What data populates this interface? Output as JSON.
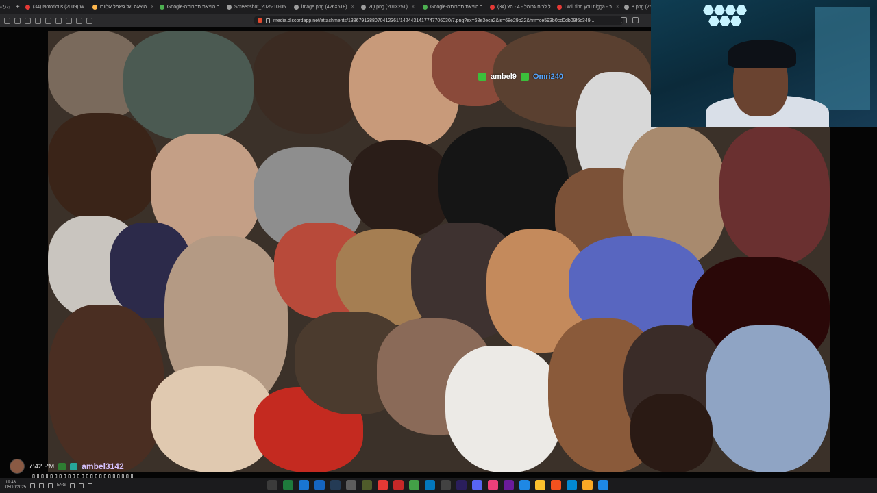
{
  "browser": {
    "tabs": [
      {
        "label": "(34) Notorious (2009) W",
        "color": "#e53935"
      },
      {
        "label": "הוצאה של גיאמל אלוורו",
        "color": "#ffb74d"
      },
      {
        "label": "Google-ב הוצאת תחרותה",
        "color": "#4caf50"
      },
      {
        "label": "Screenshot_2025-10-05",
        "color": "#9e9e9e"
      },
      {
        "label": "image.png (426×618)",
        "color": "#9e9e9e"
      },
      {
        "label": "2Q.png (201×251)",
        "color": "#9e9e9e"
      },
      {
        "label": "Google-ב הוצאת תחרותה",
        "color": "#4caf50"
      },
      {
        "label": "(34) ל לרוח גבוהל - 4 - הצ",
        "color": "#e53935"
      },
      {
        "label": "i will find you nigga - ב",
        "color": "#e53935"
      },
      {
        "label": "8.png (25",
        "color": "#9e9e9e"
      }
    ],
    "new_tab_label": "+",
    "url": "media.discordapp.net/attachments/1386791388070412361/1424431417747706030/7.png?ex=68e3eca2&is=68e29b22&hm=ce593b0cd0db09f6c349..."
  },
  "overlay": {
    "name1": "ambel9",
    "name2": "Omri240"
  },
  "chat": {
    "time": "7:42 PM",
    "username": "ambel3142",
    "message": "▯▯▯▯▯▯▯▯▯▯▯▯▯▯▯▯▯▯▯▯▯▯▯",
    "badge_colors": [
      "#2e7d32",
      "#26a69a"
    ]
  },
  "taskbar": {
    "clock_time": "19:43",
    "clock_date": "05/10/2025",
    "language": "ENG",
    "apps": [
      {
        "icon": "media-player-icon",
        "color": "#3b3b3b"
      },
      {
        "icon": "excel-icon",
        "color": "#1e7a3c"
      },
      {
        "icon": "edge-icon",
        "color": "#1976d2"
      },
      {
        "icon": "photos-icon",
        "color": "#1565c0"
      },
      {
        "icon": "steam-icon",
        "color": "#243b55"
      },
      {
        "icon": "files-icon",
        "color": "#5d5d5d"
      },
      {
        "icon": "gamepad-icon",
        "color": "#4f5b2a"
      },
      {
        "icon": "youtube-icon",
        "color": "#e53935"
      },
      {
        "icon": "pdf-icon",
        "color": "#c62828"
      },
      {
        "icon": "maps-icon",
        "color": "#43a047"
      },
      {
        "icon": "store-icon",
        "color": "#0277bd"
      },
      {
        "icon": "obs-icon",
        "color": "#424242"
      },
      {
        "icon": "premiere-icon",
        "color": "#2a1e5c"
      },
      {
        "icon": "discord-icon",
        "color": "#5865f2"
      },
      {
        "icon": "sticky-icon",
        "color": "#ec407a"
      },
      {
        "icon": "vpn-icon",
        "color": "#6a1b9a"
      },
      {
        "icon": "messenger-icon",
        "color": "#1e88e5"
      },
      {
        "icon": "chrome-icon",
        "color": "#fbc02d"
      },
      {
        "icon": "brave-icon",
        "color": "#f4511e"
      },
      {
        "icon": "edge-alt-icon",
        "color": "#0288d1"
      },
      {
        "icon": "folder-icon",
        "color": "#f9a825"
      },
      {
        "icon": "windows-icon",
        "color": "#1e88e5"
      }
    ]
  }
}
